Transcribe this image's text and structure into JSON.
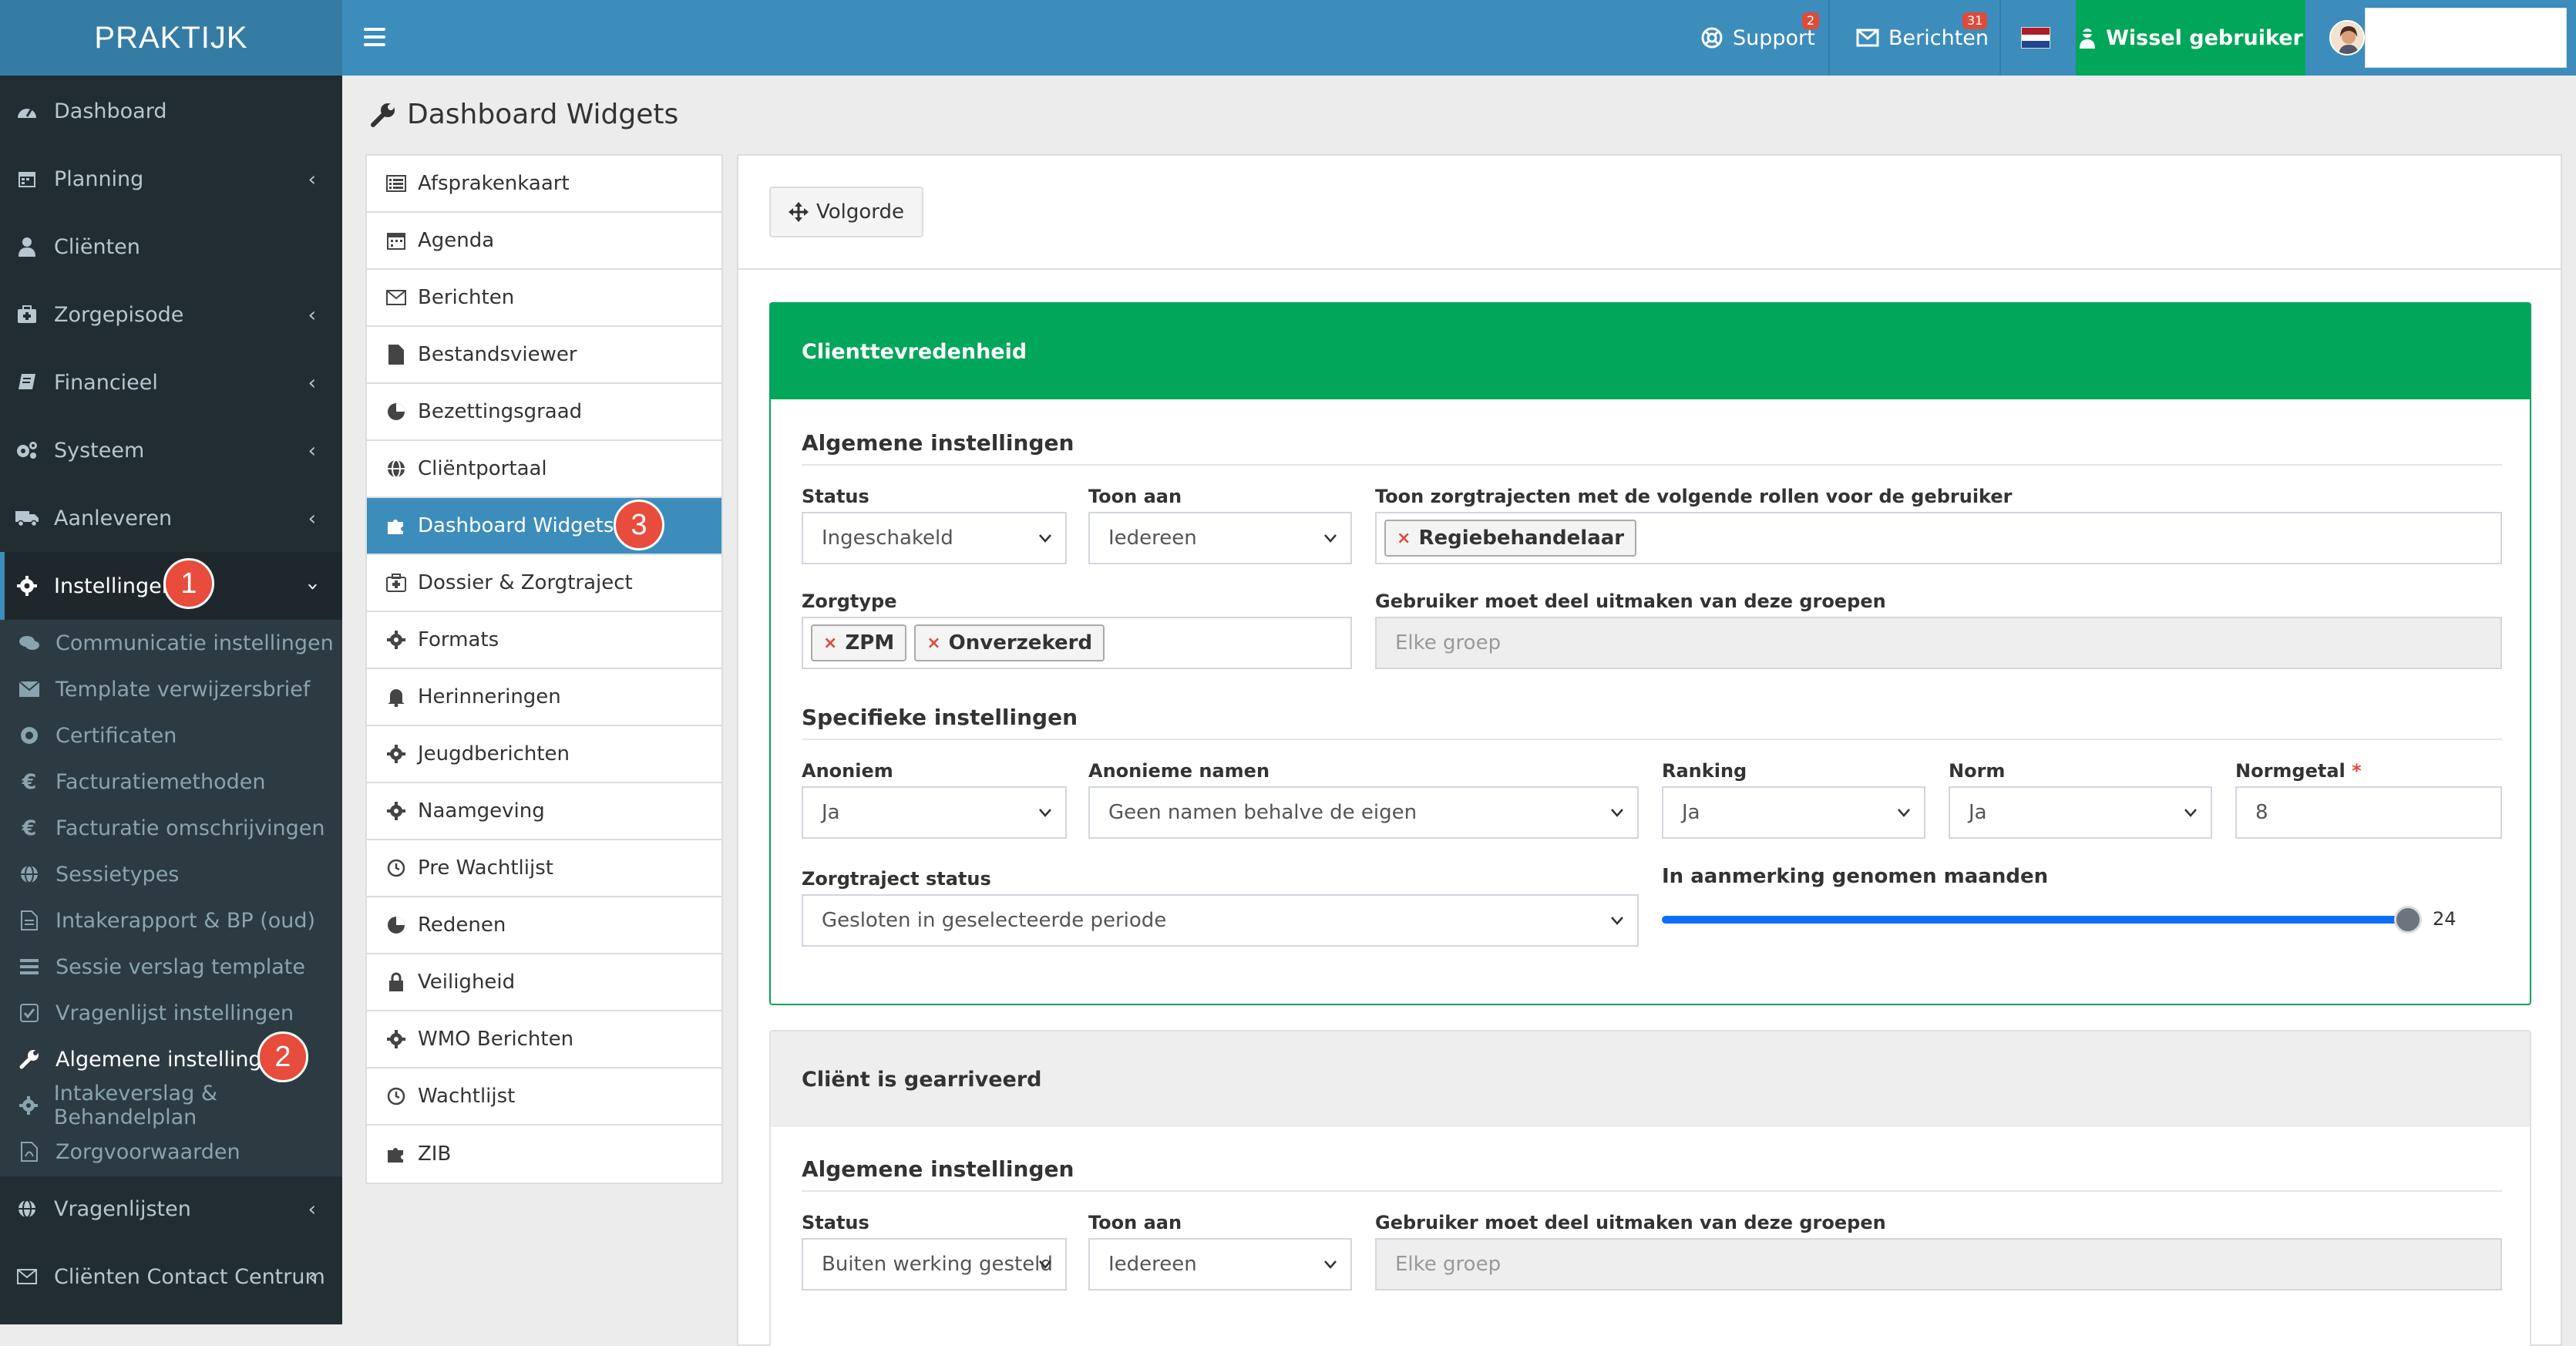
{
  "header": {
    "logo": "PRAKTIJK",
    "support_label": "Support",
    "support_badge": "2",
    "berichten_label": "Berichten",
    "berichten_badge": "31",
    "switch_user_label": "Wissel gebruiker"
  },
  "sidebar": {
    "items": [
      {
        "label": "Dashboard"
      },
      {
        "label": "Planning"
      },
      {
        "label": "Cliënten"
      },
      {
        "label": "Zorgepisode"
      },
      {
        "label": "Financieel"
      },
      {
        "label": "Systeem"
      },
      {
        "label": "Aanleveren"
      },
      {
        "label": "Instellingen"
      }
    ],
    "submenu": [
      {
        "label": "Communicatie instellingen"
      },
      {
        "label": "Template verwijzersbrief"
      },
      {
        "label": "Certificaten"
      },
      {
        "label": "Facturatiemethoden"
      },
      {
        "label": "Facturatie omschrijvingen"
      },
      {
        "label": "Sessietypes"
      },
      {
        "label": "Intakerapport & BP (oud)"
      },
      {
        "label": "Sessie verslag template"
      },
      {
        "label": "Vragenlijst instellingen"
      },
      {
        "label": "Algemene instellingen"
      },
      {
        "label": "Intakeverslag & Behandelplan"
      },
      {
        "label": "Zorgvoorwaarden"
      }
    ],
    "bottom": [
      {
        "label": "Vragenlijsten"
      },
      {
        "label": "Cliënten Contact Centrum"
      }
    ],
    "markers": [
      "1",
      "2"
    ]
  },
  "page": {
    "title": "Dashboard Widgets",
    "marker": "3"
  },
  "widget_menu": [
    {
      "label": "Afsprakenkaart"
    },
    {
      "label": "Agenda"
    },
    {
      "label": "Berichten"
    },
    {
      "label": "Bestandsviewer"
    },
    {
      "label": "Bezettingsgraad"
    },
    {
      "label": "Cliëntportaal"
    },
    {
      "label": "Dashboard Widgets"
    },
    {
      "label": "Dossier & Zorgtraject"
    },
    {
      "label": "Formats"
    },
    {
      "label": "Herinneringen"
    },
    {
      "label": "Jeugdberichten"
    },
    {
      "label": "Naamgeving"
    },
    {
      "label": "Pre Wachtlijst"
    },
    {
      "label": "Redenen"
    },
    {
      "label": "Veiligheid"
    },
    {
      "label": "WMO Berichten"
    },
    {
      "label": "Wachtlijst"
    },
    {
      "label": "ZIB"
    }
  ],
  "order_button": "Volgorde",
  "widget1": {
    "title": "Clienttevredenheid",
    "general_title": "Algemene instellingen",
    "status_label": "Status",
    "status_value": "Ingeschakeld",
    "show_to_label": "Toon aan",
    "show_to_value": "Iedereen",
    "roles_label": "Toon zorgtrajecten met de volgende rollen voor de gebruiker",
    "roles_tags": [
      "Regiebehandelaar"
    ],
    "zorgtype_label": "Zorgtype",
    "zorgtype_tags": [
      "ZPM",
      "Onverzekerd"
    ],
    "groups_label": "Gebruiker moet deel uitmaken van deze groepen",
    "groups_placeholder": "Elke groep",
    "specific_title": "Specifieke instellingen",
    "anoniem_label": "Anoniem",
    "anoniem_value": "Ja",
    "anon_names_label": "Anonieme namen",
    "anon_names_value": "Geen namen behalve de eigen",
    "ranking_label": "Ranking",
    "ranking_value": "Ja",
    "norm_label": "Norm",
    "norm_value": "Ja",
    "normgetal_label": "Normgetal",
    "normgetal_required": "*",
    "normgetal_value": "8",
    "traject_status_label": "Zorgtraject status",
    "traject_status_value": "Gesloten in geselecteerde periode",
    "months_label": "In aanmerking genomen maanden",
    "months_value": "24"
  },
  "widget2": {
    "title": "Cliënt is gearriveerd",
    "general_title": "Algemene instellingen",
    "status_label": "Status",
    "status_value": "Buiten werking gesteld",
    "show_to_label": "Toon aan",
    "show_to_value": "Iedereen",
    "groups_label": "Gebruiker moet deel uitmaken van deze groepen",
    "groups_placeholder": "Elke groep"
  },
  "colors": {
    "header_blue": "#3c8dbc",
    "sidebar_dark": "#222d32",
    "success_green": "#00a65a",
    "marker_red": "#e74c3c"
  }
}
